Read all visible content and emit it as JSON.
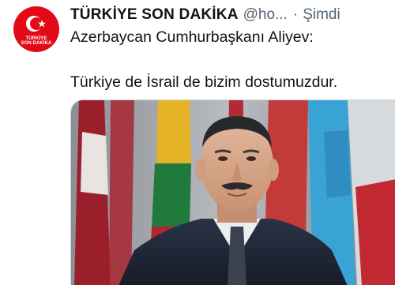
{
  "account": {
    "avatar_line1": "TÜRKİYE",
    "avatar_line2": "SON DAKİKA",
    "display_name": "TÜRKİYE SON DAKİKA",
    "handle": "@ho...",
    "separator": "·",
    "timestamp": "Şimdi"
  },
  "tweet": {
    "line1": "Azerbaycan Cumhurbaşkanı Aliyev:",
    "line2": "Türkiye de İsrail de bizim dostumuzdur."
  },
  "colors": {
    "brand_red": "#e30a17",
    "text_primary": "#0f1419",
    "text_secondary": "#536471"
  }
}
